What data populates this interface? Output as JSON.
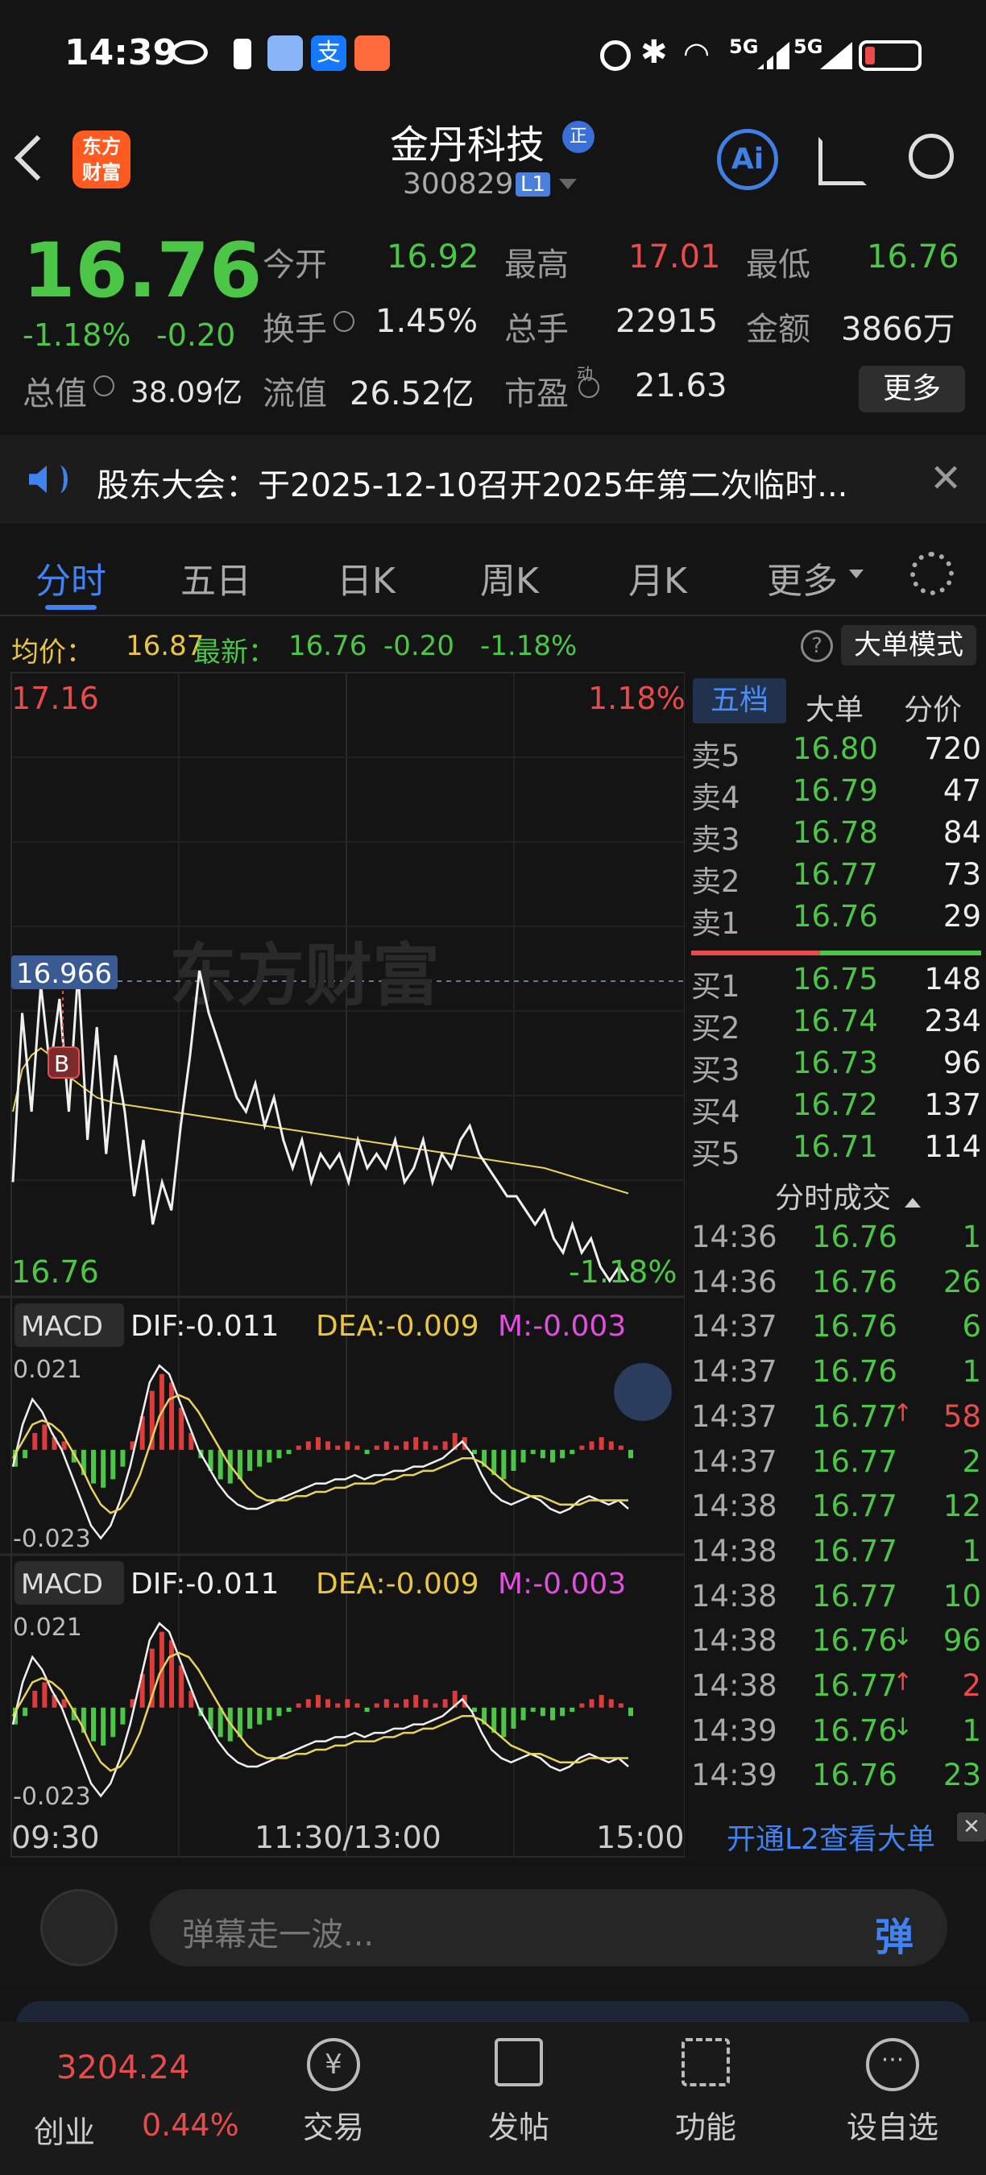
{
  "status_bar": {
    "time": "14:39",
    "signal1": "5G",
    "signal2": "5G"
  },
  "header": {
    "stock_name": "金丹科技",
    "stock_code": "300829",
    "level_badge": "L1",
    "logo_line1": "东方",
    "logo_line2": "财富",
    "verified": "正",
    "ai_label": "Ai"
  },
  "quote": {
    "price": "16.76",
    "change_pct": "-1.18%",
    "change": "-0.20",
    "rows": [
      {
        "l1": "今开",
        "v1": "16.92",
        "l2": "最高",
        "v2": "17.01",
        "l3": "最低",
        "v3": "16.76"
      },
      {
        "l1": "换手",
        "v1": "1.45%",
        "l2": "总手",
        "v2": "22915",
        "l3": "金额",
        "v3": "3866万"
      },
      {
        "l1": "总值",
        "v1": "38.09亿",
        "l2": "流值",
        "v2": "26.52亿",
        "l3": "市盈",
        "l3sup": "动",
        "v3": "21.63"
      }
    ],
    "more_button": "更多"
  },
  "notice": {
    "text": "股东大会：于2025-12-10召开2025年第二次临时..."
  },
  "tabs": [
    "分时",
    "五日",
    "日K",
    "周K",
    "月K",
    "更多"
  ],
  "avg_bar": {
    "avg_label": "均价：",
    "avg_value": "16.87",
    "latest_label": "最新：",
    "latest_value": "16.76",
    "change": "-0.20",
    "change_pct": "-1.18%",
    "big_order_mode": "大单模式"
  },
  "chart_data": {
    "type": "line",
    "y_top": "17.16",
    "y_top_pct": "1.18%",
    "y_bottom": "16.76",
    "y_bottom_pct": "-1.18%",
    "marker_price": "16.966",
    "marker_label": "B",
    "watermark": "东方财富",
    "x_labels": [
      "09:30",
      "11:30/13:00",
      "15:00"
    ],
    "ylim": [
      16.76,
      17.16
    ],
    "price": [
      16.83,
      16.95,
      16.88,
      16.97,
      16.91,
      16.96,
      16.88,
      16.98,
      16.86,
      16.94,
      16.85,
      16.92,
      16.88,
      16.82,
      16.86,
      16.8,
      16.83,
      16.81,
      16.87,
      16.92,
      16.98,
      16.95,
      16.93,
      16.91,
      16.89,
      16.88,
      16.9,
      16.87,
      16.89,
      16.86,
      16.84,
      16.86,
      16.83,
      16.85,
      16.84,
      16.85,
      16.83,
      16.86,
      16.84,
      16.85,
      16.84,
      16.86,
      16.83,
      16.84,
      16.86,
      16.83,
      16.85,
      16.84,
      16.86,
      16.87,
      16.85,
      16.84,
      16.83,
      16.82,
      16.82,
      16.81,
      16.8,
      16.81,
      16.79,
      16.78,
      16.8,
      16.78,
      16.79,
      16.77,
      16.76,
      16.77,
      16.76
    ],
    "avg": [
      16.88,
      16.91,
      16.92,
      16.925,
      16.92,
      16.91,
      16.905,
      16.9,
      16.895,
      16.89,
      16.888,
      16.886,
      16.885,
      16.884,
      16.883,
      16.882,
      16.881,
      16.88,
      16.879,
      16.878,
      16.877,
      16.876,
      16.875,
      16.874,
      16.873,
      16.872,
      16.871,
      16.87,
      16.869,
      16.868,
      16.867,
      16.866,
      16.865,
      16.864,
      16.863,
      16.862,
      16.861,
      16.86,
      16.859,
      16.858,
      16.857,
      16.856,
      16.855,
      16.854,
      16.853,
      16.852,
      16.851,
      16.85,
      16.849,
      16.848,
      16.847,
      16.846,
      16.845,
      16.844,
      16.843,
      16.842,
      16.841,
      16.84,
      16.838,
      16.836,
      16.834,
      16.832,
      16.83,
      16.828,
      16.826,
      16.824,
      16.822
    ],
    "macd_header": {
      "label": "MACD",
      "dif": "DIF:-0.011",
      "dea": "DEA:-0.009",
      "m": "M:-0.003"
    },
    "macd_ylim": [
      -0.023,
      0.021
    ],
    "macd_top": "0.021",
    "macd_bottom": "-0.023",
    "macd_hist": [
      -0.004,
      -0.002,
      0.004,
      0.006,
      0.003,
      0.002,
      -0.003,
      -0.006,
      -0.008,
      -0.009,
      -0.007,
      -0.004,
      0.002,
      0.008,
      0.014,
      0.018,
      0.016,
      0.01,
      0.004,
      -0.002,
      -0.005,
      -0.007,
      -0.008,
      -0.007,
      -0.005,
      -0.004,
      -0.003,
      -0.002,
      -0.001,
      0.001,
      0.002,
      0.003,
      0.002,
      0.001,
      0.002,
      0.001,
      -0.001,
      0.001,
      0.002,
      0.001,
      0.002,
      0.003,
      0.002,
      0.001,
      0.002,
      0.004,
      0.003,
      -0.001,
      -0.004,
      -0.006,
      -0.007,
      -0.005,
      -0.003,
      -0.001,
      -0.002,
      -0.003,
      -0.002,
      -0.001,
      0.001,
      0.002,
      0.003,
      0.002,
      0.001,
      -0.002
    ],
    "dif": [
      -0.004,
      0.006,
      0.012,
      0.009,
      0.004,
      0.0,
      -0.006,
      -0.012,
      -0.018,
      -0.021,
      -0.018,
      -0.012,
      -0.004,
      0.006,
      0.016,
      0.02,
      0.018,
      0.012,
      0.006,
      0.0,
      -0.004,
      -0.008,
      -0.011,
      -0.013,
      -0.014,
      -0.014,
      -0.013,
      -0.012,
      -0.011,
      -0.01,
      -0.009,
      -0.008,
      -0.008,
      -0.007,
      -0.007,
      -0.006,
      -0.007,
      -0.006,
      -0.006,
      -0.005,
      -0.005,
      -0.004,
      -0.004,
      -0.003,
      -0.002,
      0.0,
      0.002,
      -0.001,
      -0.006,
      -0.01,
      -0.012,
      -0.013,
      -0.012,
      -0.011,
      -0.012,
      -0.014,
      -0.015,
      -0.014,
      -0.012,
      -0.011,
      -0.012,
      -0.013,
      -0.012,
      -0.014
    ],
    "dea": [
      -0.002,
      0.002,
      0.006,
      0.007,
      0.006,
      0.004,
      0.0,
      -0.004,
      -0.009,
      -0.013,
      -0.015,
      -0.014,
      -0.011,
      -0.006,
      0.001,
      0.008,
      0.012,
      0.013,
      0.012,
      0.009,
      0.005,
      0.001,
      -0.003,
      -0.006,
      -0.009,
      -0.011,
      -0.012,
      -0.012,
      -0.012,
      -0.011,
      -0.011,
      -0.01,
      -0.01,
      -0.009,
      -0.009,
      -0.008,
      -0.008,
      -0.008,
      -0.007,
      -0.007,
      -0.006,
      -0.006,
      -0.005,
      -0.005,
      -0.004,
      -0.003,
      -0.002,
      -0.002,
      -0.003,
      -0.005,
      -0.007,
      -0.009,
      -0.01,
      -0.011,
      -0.011,
      -0.012,
      -0.013,
      -0.013,
      -0.013,
      -0.012,
      -0.012,
      -0.012,
      -0.012,
      -0.012
    ]
  },
  "orderbook": {
    "tabs": [
      "五档",
      "大单",
      "分价"
    ],
    "asks": [
      {
        "l": "卖5",
        "p": "16.80",
        "v": "720"
      },
      {
        "l": "卖4",
        "p": "16.79",
        "v": "47"
      },
      {
        "l": "卖3",
        "p": "16.78",
        "v": "84"
      },
      {
        "l": "卖2",
        "p": "16.77",
        "v": "73"
      },
      {
        "l": "卖1",
        "p": "16.76",
        "v": "29"
      }
    ],
    "bids": [
      {
        "l": "买1",
        "p": "16.75",
        "v": "148"
      },
      {
        "l": "买2",
        "p": "16.74",
        "v": "234"
      },
      {
        "l": "买3",
        "p": "16.73",
        "v": "96"
      },
      {
        "l": "买4",
        "p": "16.72",
        "v": "137"
      },
      {
        "l": "买5",
        "p": "16.71",
        "v": "114"
      }
    ],
    "trades_title": "分时成交",
    "trades": [
      {
        "t": "14:36",
        "p": "16.76",
        "v": "1",
        "dir": ""
      },
      {
        "t": "14:36",
        "p": "16.76",
        "v": "26",
        "dir": ""
      },
      {
        "t": "14:37",
        "p": "16.76",
        "v": "6",
        "dir": ""
      },
      {
        "t": "14:37",
        "p": "16.76",
        "v": "1",
        "dir": ""
      },
      {
        "t": "14:37",
        "p": "16.77",
        "v": "58",
        "dir": "up"
      },
      {
        "t": "14:37",
        "p": "16.77",
        "v": "2",
        "dir": ""
      },
      {
        "t": "14:38",
        "p": "16.77",
        "v": "12",
        "dir": ""
      },
      {
        "t": "14:38",
        "p": "16.77",
        "v": "1",
        "dir": ""
      },
      {
        "t": "14:38",
        "p": "16.77",
        "v": "10",
        "dir": ""
      },
      {
        "t": "14:38",
        "p": "16.76",
        "v": "96",
        "dir": "down"
      },
      {
        "t": "14:38",
        "p": "16.77",
        "v": "2",
        "dir": "up"
      },
      {
        "t": "14:39",
        "p": "16.76",
        "v": "1",
        "dir": "down"
      },
      {
        "t": "14:39",
        "p": "16.76",
        "v": "23",
        "dir": ""
      }
    ],
    "l2_link": "开通L2查看大单"
  },
  "danmaku": {
    "placeholder": "弹幕走一波...",
    "send_label": "弹"
  },
  "tabbar": {
    "index_value": "3204.24",
    "index_name": "创业",
    "index_pct": "0.44%",
    "items": [
      "交易",
      "发帖",
      "功能",
      "设自选"
    ]
  }
}
